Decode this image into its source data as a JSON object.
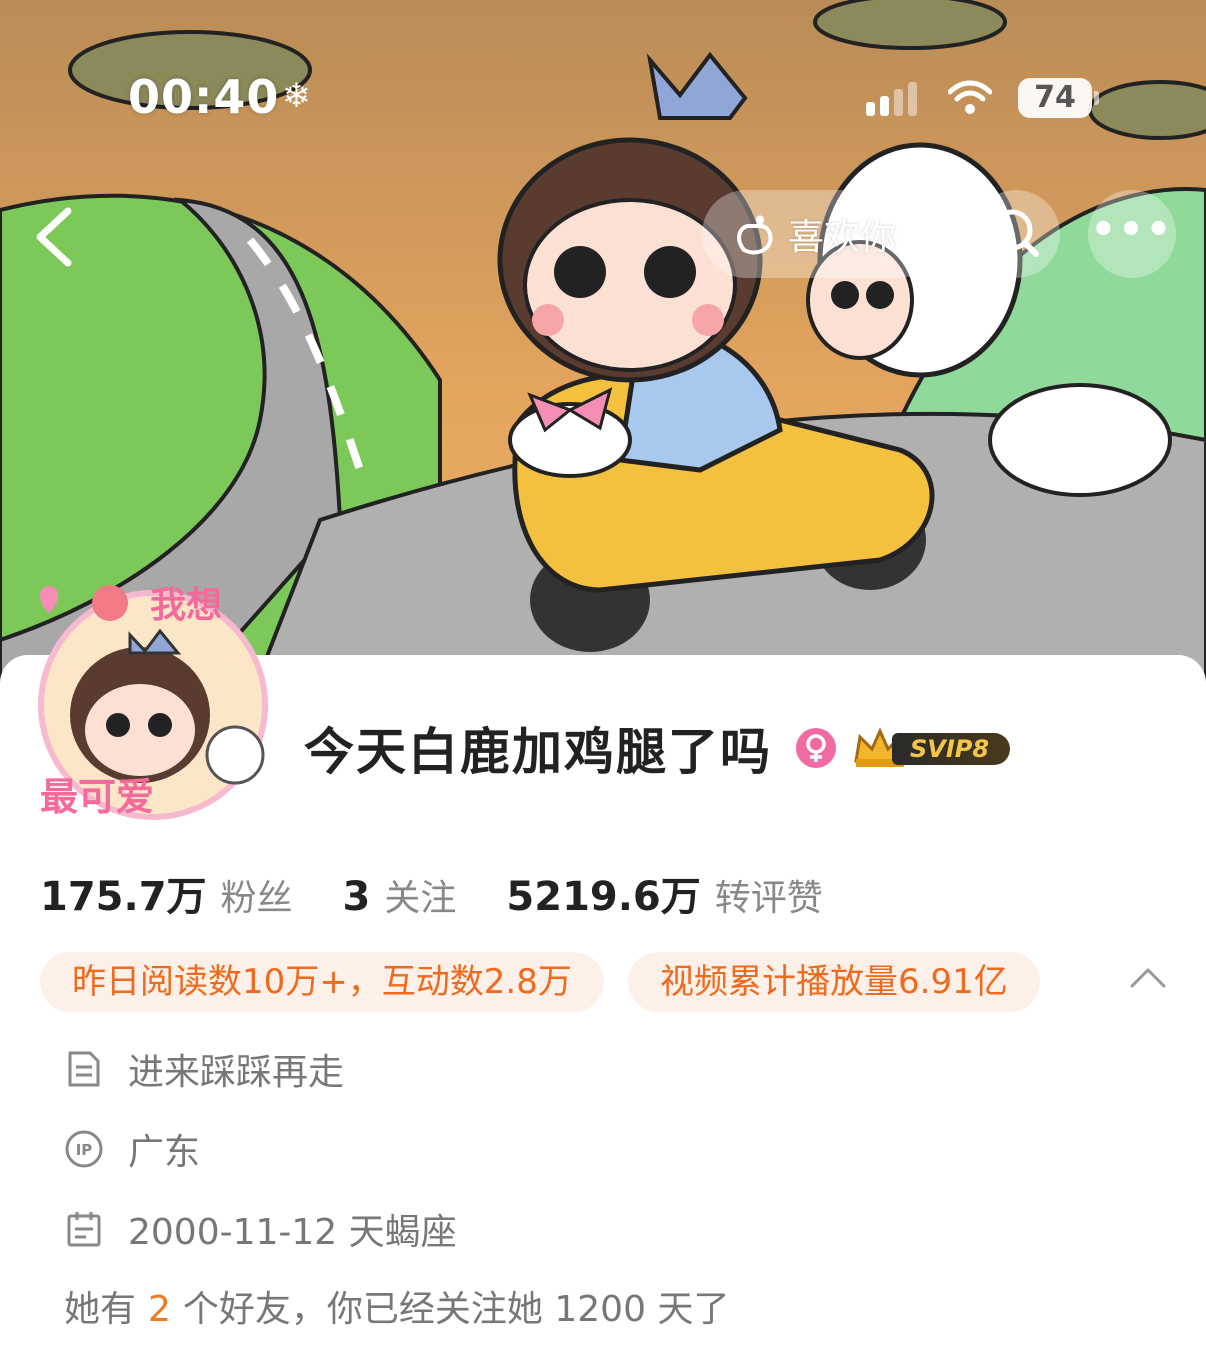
{
  "status_bar": {
    "time": "00:40",
    "snow_glyph": "❄",
    "battery": "74"
  },
  "nav": {
    "back_icon": "chevron-left-icon",
    "like_label": "喜欢你",
    "like_icon": "hand-heart-icon",
    "search_icon": "search-icon",
    "more_label": "•••"
  },
  "profile": {
    "name": "今天白鹿加鸡腿了吗",
    "gender_icon": "female-icon",
    "vip_badge": "SVIP8",
    "stats": [
      {
        "value": "175.7万",
        "label": "粉丝"
      },
      {
        "value": "3",
        "label": "关注"
      },
      {
        "value": "5219.6万",
        "label": "转评赞"
      }
    ],
    "tags": [
      "昨日阅读数10万+，互动数2.8万",
      "视频累计播放量6.91亿"
    ],
    "bio": "进来踩踩再走",
    "location": "广东",
    "birthday": "2000-11-12 天蝎座",
    "friends": {
      "prefix": "她有",
      "count": "2",
      "suffix": "个好友，你已经关注她 1200 天了"
    }
  },
  "colors": {
    "accent": "#f06a1e",
    "tag_bg": "#fdf0e8",
    "female": "#f06ba4"
  }
}
